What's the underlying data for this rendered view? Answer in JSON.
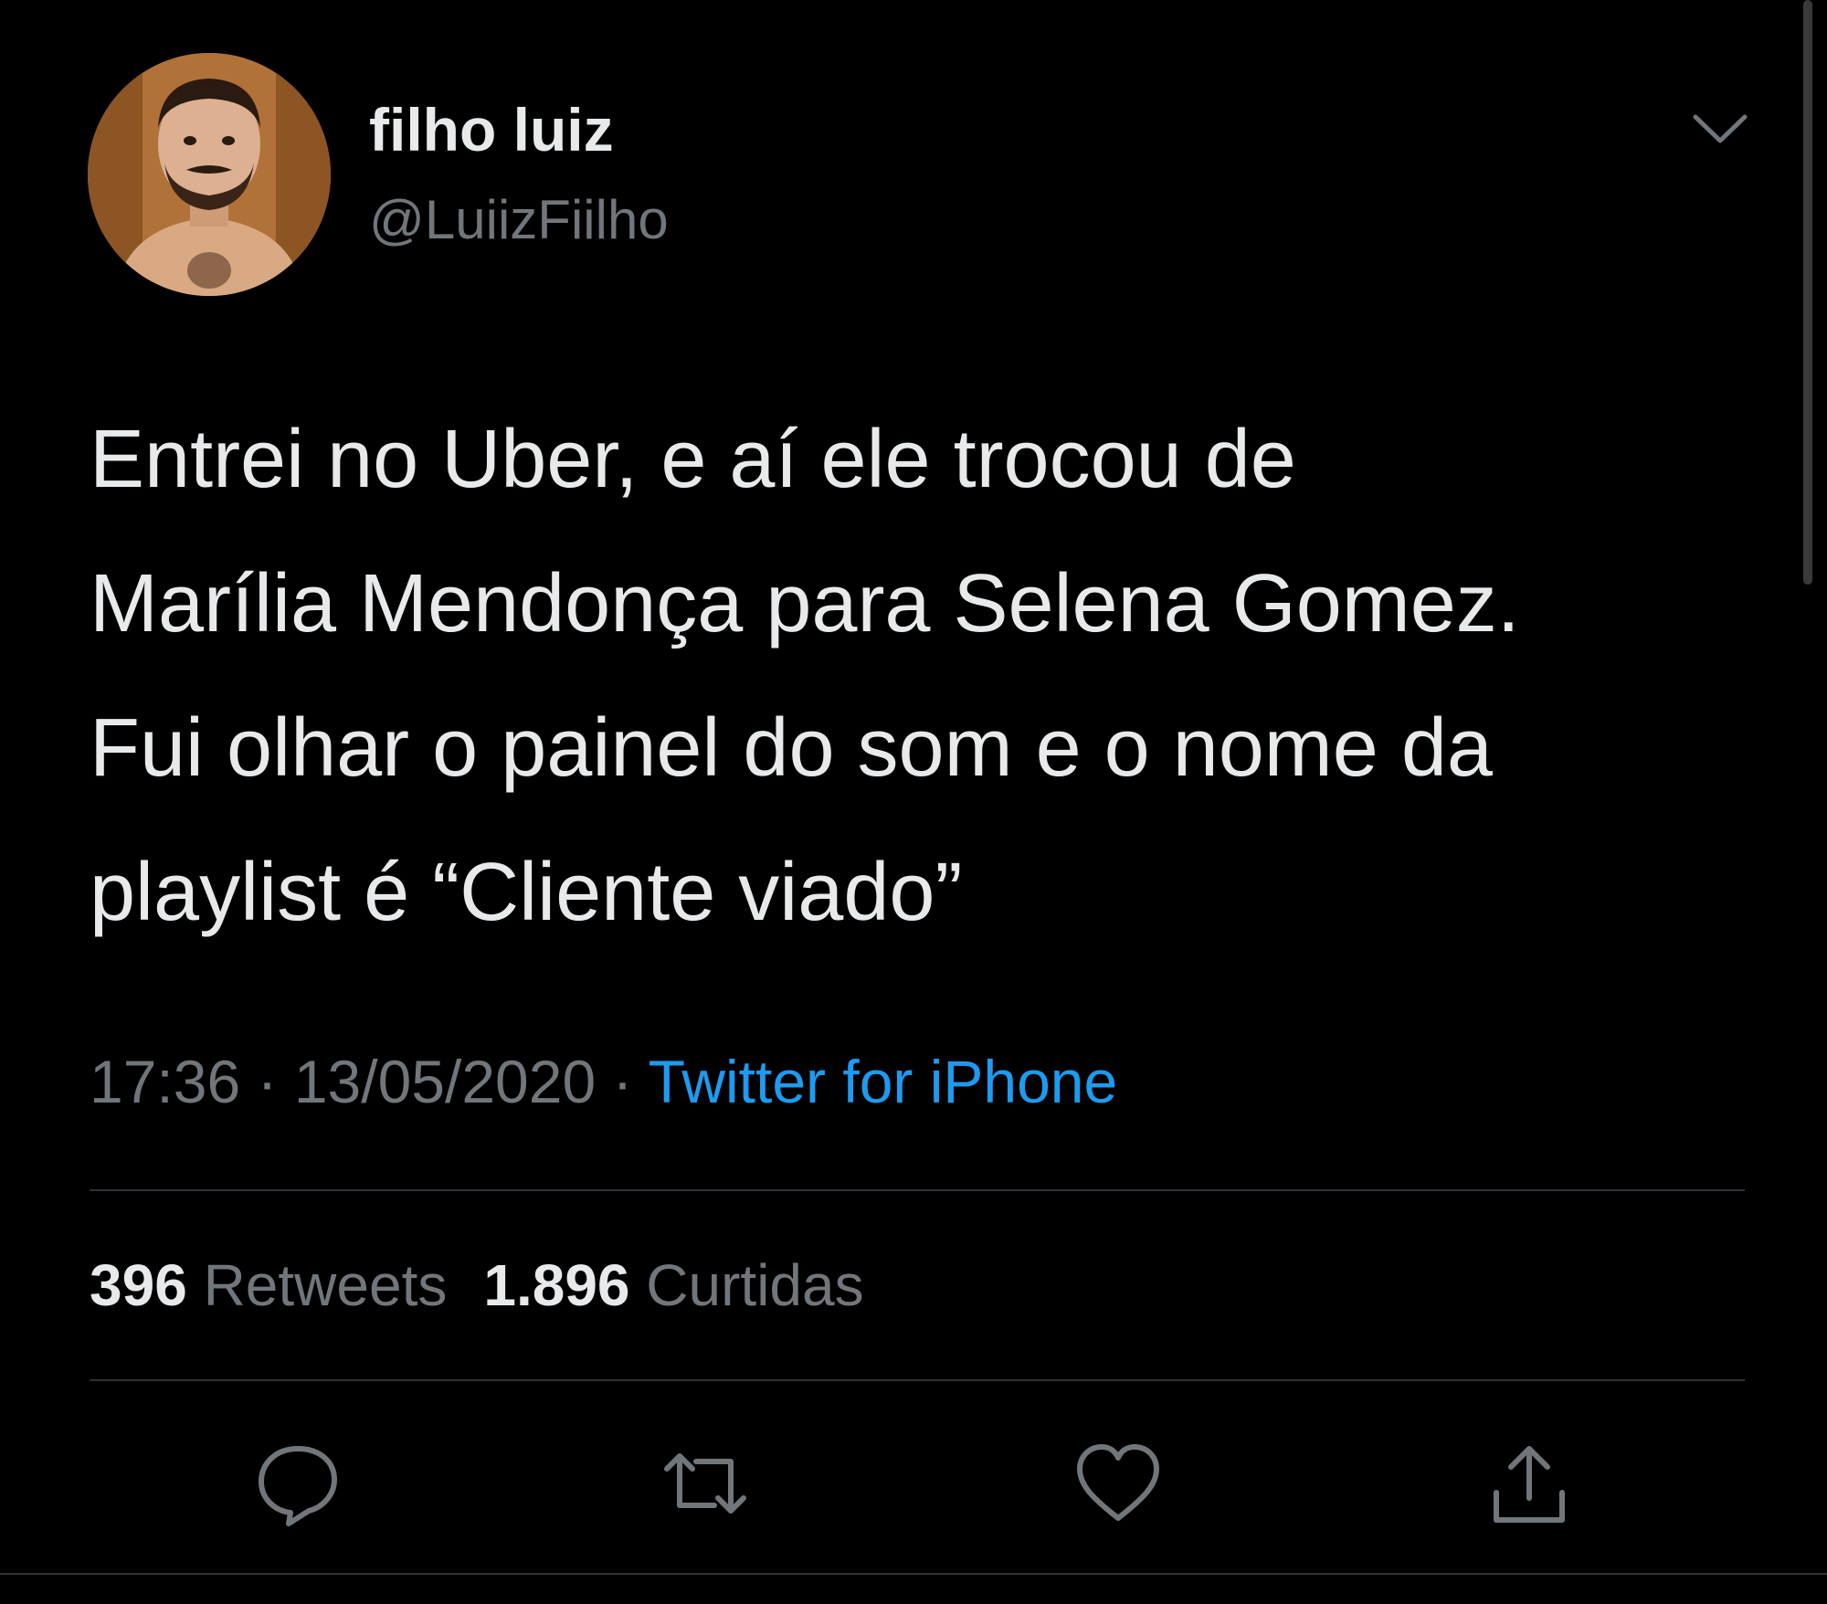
{
  "tweet": {
    "display_name": "filho luiz",
    "handle": "@LuiizFiilho",
    "text_lines": [
      "Entrei no Uber, e aí ele trocou de",
      "Marília Mendonça para Selena Gomez.",
      "Fui olhar o painel do som e o nome da",
      "playlist é “Cliente viado”"
    ],
    "time": "17:36",
    "date": "13/05/2020",
    "separator": "·",
    "source": "Twitter for iPhone"
  },
  "stats": {
    "retweets_count": "396",
    "retweets_label": "Retweets",
    "likes_count": "1.896",
    "likes_label": "Curtidas"
  },
  "actions": {
    "reply_icon": "reply-icon",
    "retweet_icon": "retweet-icon",
    "like_icon": "heart-icon",
    "share_icon": "share-icon"
  },
  "colors": {
    "background": "#000000",
    "text_primary": "#e7e9ea",
    "text_secondary": "#71767b",
    "link": "#1d9bf0",
    "divider": "#2f3336"
  }
}
